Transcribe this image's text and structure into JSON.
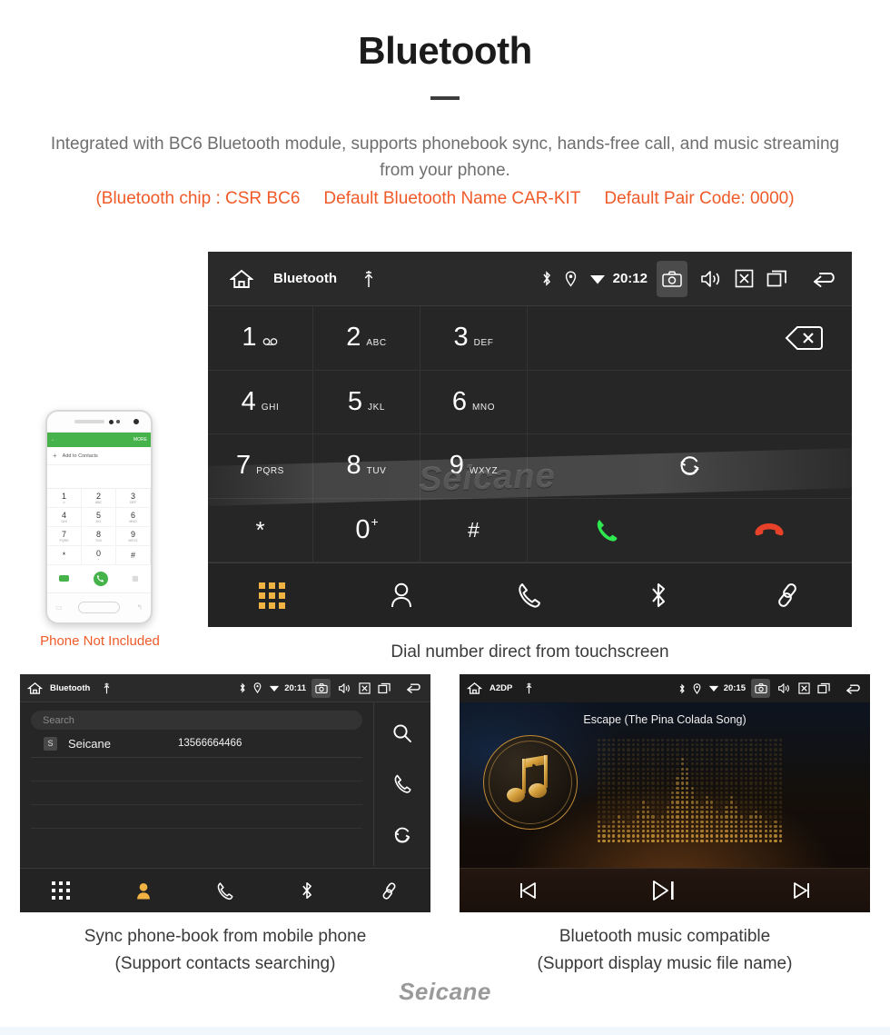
{
  "header": {
    "title": "Bluetooth",
    "description": "Integrated with BC6 Bluetooth module, supports phonebook sync, hands-free call, and music streaming from your phone.",
    "spec_chip": "(Bluetooth chip : CSR BC6",
    "spec_name": "Default Bluetooth Name CAR-KIT",
    "spec_pair": "Default Pair Code: 0000)",
    "accent_color": "#f05a28",
    "body_color": "#6e6e6e"
  },
  "dialer": {
    "statusbar": {
      "home_icon": "home-icon",
      "title": "Bluetooth",
      "usb_icon": "usb-icon",
      "bluetooth_icon": "bluetooth-icon",
      "location_icon": "location-icon",
      "wifi_icon": "wifi-icon",
      "time": "20:12",
      "camera_icon": "camera-icon",
      "volume_icon": "volume-icon",
      "mute_icon": "mute-x-icon",
      "recents_icon": "recents-icon",
      "back_icon": "back-arrow-icon"
    },
    "keys": [
      {
        "num": "1",
        "sub": "∞",
        "name": "key-1"
      },
      {
        "num": "2",
        "sub": "ABC",
        "name": "key-2"
      },
      {
        "num": "3",
        "sub": "DEF",
        "name": "key-3"
      },
      {
        "num": "4",
        "sub": "GHI",
        "name": "key-4"
      },
      {
        "num": "5",
        "sub": "JKL",
        "name": "key-5"
      },
      {
        "num": "6",
        "sub": "MNO",
        "name": "key-6"
      },
      {
        "num": "7",
        "sub": "PQRS",
        "name": "key-7"
      },
      {
        "num": "8",
        "sub": "TUV",
        "name": "key-8"
      },
      {
        "num": "9",
        "sub": "WXYZ",
        "name": "key-9"
      },
      {
        "num": "*",
        "sub": "",
        "name": "key-star"
      },
      {
        "num": "0",
        "sub": "",
        "name": "key-0"
      },
      {
        "num": "#",
        "sub": "",
        "name": "key-hash"
      }
    ],
    "actions": {
      "backspace_icon": "backspace-icon",
      "transfer_icon": "call-transfer-icon",
      "call_icon": "call-green-icon",
      "hangup_icon": "hangup-red-icon",
      "call_color": "#2ee84f",
      "hangup_color": "#e8412a"
    },
    "navbar": [
      {
        "name": "nav-dialpad",
        "icon": "dialpad-icon",
        "active": true
      },
      {
        "name": "nav-contacts",
        "icon": "person-icon",
        "active": false
      },
      {
        "name": "nav-calllog",
        "icon": "handset-icon",
        "active": false
      },
      {
        "name": "nav-bluetooth",
        "icon": "bluetooth-icon",
        "active": false
      },
      {
        "name": "nav-link",
        "icon": "link-icon",
        "active": false
      }
    ],
    "watermark": "Seicane",
    "caption": "Dial number direct from touchscreen"
  },
  "phone_mockup": {
    "screen_back": "←",
    "screen_more": "MORE",
    "add_label": "Add to Contacts",
    "add_plus": "+",
    "keys": [
      {
        "num": "1",
        "sub": "∞"
      },
      {
        "num": "2",
        "sub": "ABC"
      },
      {
        "num": "3",
        "sub": "DEF"
      },
      {
        "num": "4",
        "sub": "GHI"
      },
      {
        "num": "5",
        "sub": "JKL"
      },
      {
        "num": "6",
        "sub": "MNO"
      },
      {
        "num": "7",
        "sub": "PQRS"
      },
      {
        "num": "8",
        "sub": "TUV"
      },
      {
        "num": "9",
        "sub": "WXYZ"
      },
      {
        "num": "*",
        "sub": ""
      },
      {
        "num": "0",
        "sub": "+"
      },
      {
        "num": "#",
        "sub": ""
      }
    ],
    "note": "Phone Not Included",
    "note_color": "#f05a28",
    "accent_green": "#45b24a"
  },
  "phonebook": {
    "statusbar": {
      "title": "Bluetooth",
      "time": "20:11"
    },
    "search_placeholder": "Search",
    "contacts": [
      {
        "badge": "S",
        "name": "Seicane",
        "number": "13566664466"
      }
    ],
    "side_icons": [
      {
        "name": "search-icon"
      },
      {
        "name": "handset-icon"
      },
      {
        "name": "sync-icon"
      }
    ],
    "navbar": [
      {
        "name": "nav-dialpad",
        "icon": "dialpad-icon",
        "active": false
      },
      {
        "name": "nav-contacts",
        "icon": "person-icon",
        "active": true
      },
      {
        "name": "nav-calllog",
        "icon": "handset-icon",
        "active": false
      },
      {
        "name": "nav-bluetooth",
        "icon": "bluetooth-icon",
        "active": false
      },
      {
        "name": "nav-link",
        "icon": "link-icon",
        "active": false
      }
    ],
    "caption_line1": "Sync phone-book from mobile phone",
    "caption_line2": "(Support contacts searching)"
  },
  "a2dp": {
    "statusbar": {
      "title": "A2DP",
      "time": "20:15"
    },
    "song_title": "Escape (The Pina Colada Song)",
    "controls": [
      {
        "name": "prev-button",
        "icon": "previous-track-icon"
      },
      {
        "name": "play-pause-button",
        "icon": "play-pause-icon"
      },
      {
        "name": "next-button",
        "icon": "next-track-icon"
      }
    ],
    "accent_gold": "#d8a23c",
    "caption_line1": "Bluetooth music compatible",
    "caption_line2": "(Support display music file name)"
  },
  "footer": {
    "logo": "Seicane"
  }
}
